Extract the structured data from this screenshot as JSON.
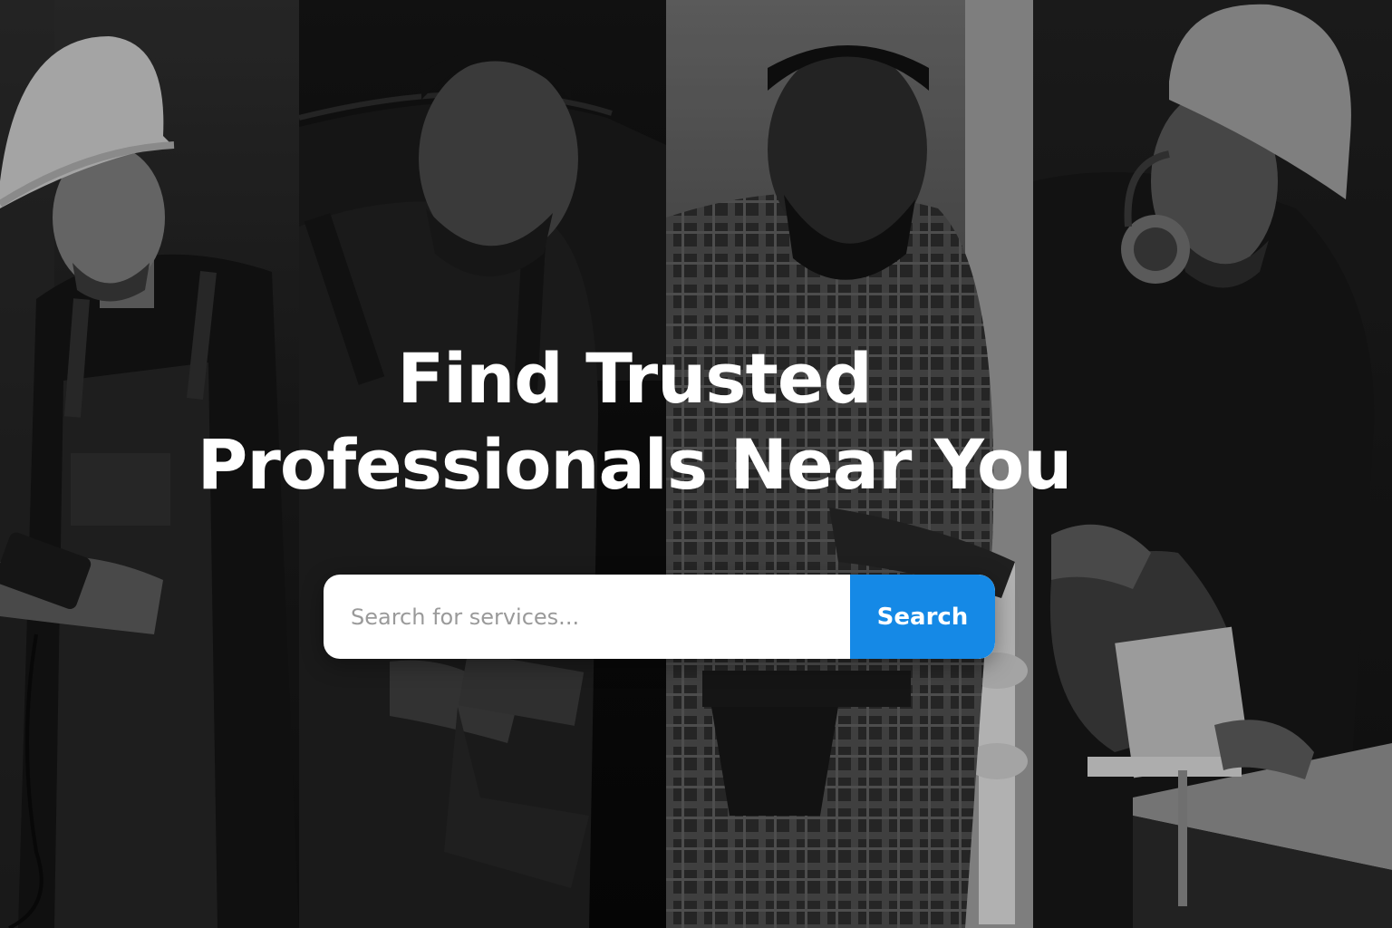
{
  "hero": {
    "headline_line1": "Find Trusted",
    "headline_line2": "Professionals Near You",
    "photos": [
      "worker-hard-hat-overalls-phone",
      "worker-overalls-mechanic",
      "worker-plaid-shirt-plumber",
      "worker-hard-hat-jigsaw-carpenter"
    ]
  },
  "search": {
    "placeholder": "Search for services...",
    "value": "",
    "button_label": "Search"
  },
  "colors": {
    "accent": "#1589e6",
    "headline": "#ffffff",
    "background": "#0b0b0b"
  }
}
